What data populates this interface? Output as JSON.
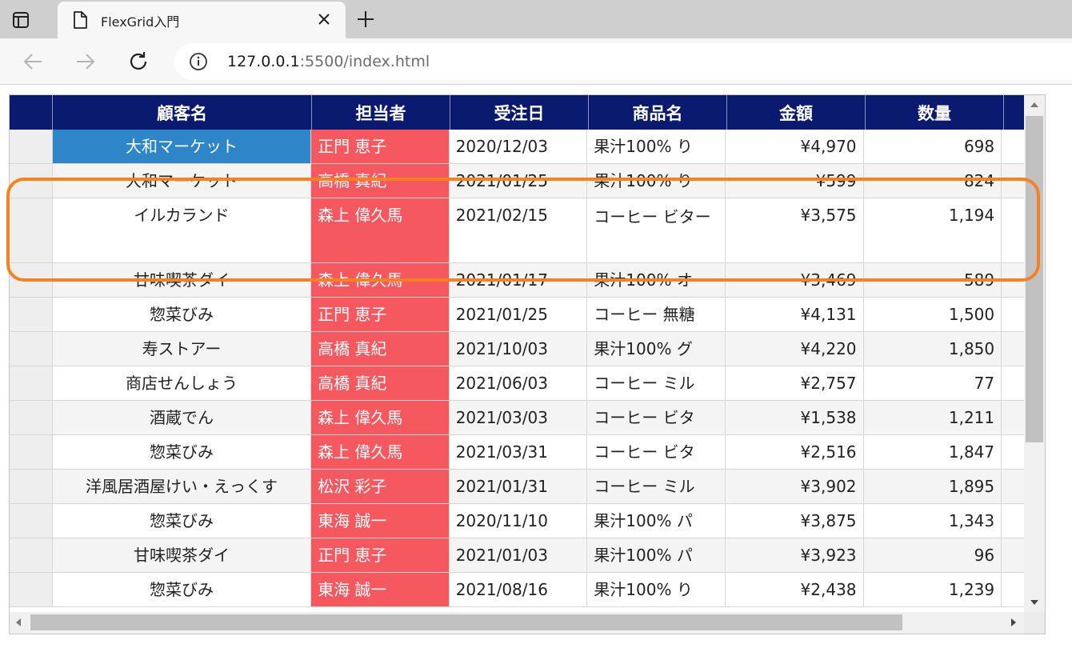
{
  "browser": {
    "tab_title": "FlexGrid入門",
    "url_host": "127.0.0.1",
    "url_path": ":5500/index.html"
  },
  "grid": {
    "columns": [
      "顧客名",
      "担当者",
      "受注日",
      "商品名",
      "金額",
      "数量"
    ],
    "rows": [
      {
        "customer": "大和マーケット",
        "staff": "正門 恵子",
        "date": "2020/12/03",
        "product": "果汁100% り",
        "amount": "¥4,970",
        "qty": "698"
      },
      {
        "customer": "大和マーケット",
        "staff": "高橋 真紀",
        "date": "2021/01/25",
        "product": "果汁100% り",
        "amount": "¥599",
        "qty": "824"
      },
      {
        "customer": "イルカランド",
        "staff": "森上 偉久馬",
        "date": "2021/02/15",
        "product": "コーヒー ビター",
        "amount": "¥3,575",
        "qty": "1,194"
      },
      {
        "customer": "甘味喫茶ダイ",
        "staff": "森上 偉久馬",
        "date": "2021/01/17",
        "product": "果汁100% オ",
        "amount": "¥3,469",
        "qty": "589"
      },
      {
        "customer": "惣菜びみ",
        "staff": "正門 恵子",
        "date": "2021/01/25",
        "product": "コーヒー 無糖",
        "amount": "¥4,131",
        "qty": "1,500"
      },
      {
        "customer": "寿ストアー",
        "staff": "高橋 真紀",
        "date": "2021/10/03",
        "product": "果汁100% グ",
        "amount": "¥4,220",
        "qty": "1,850"
      },
      {
        "customer": "商店せんしょう",
        "staff": "高橋 真紀",
        "date": "2021/06/03",
        "product": "コーヒー ミル",
        "amount": "¥2,757",
        "qty": "77"
      },
      {
        "customer": "酒蔵でん",
        "staff": "森上 偉久馬",
        "date": "2021/03/03",
        "product": "コーヒー ビタ",
        "amount": "¥1,538",
        "qty": "1,211"
      },
      {
        "customer": "惣菜びみ",
        "staff": "森上 偉久馬",
        "date": "2021/03/31",
        "product": "コーヒー ビタ",
        "amount": "¥2,516",
        "qty": "1,847"
      },
      {
        "customer": "洋風居酒屋けい・えっくす",
        "staff": "松沢 彩子",
        "date": "2021/01/31",
        "product": "コーヒー ミル",
        "amount": "¥3,902",
        "qty": "1,895"
      },
      {
        "customer": "惣菜びみ",
        "staff": "東海 誠一",
        "date": "2020/11/10",
        "product": "果汁100% パ",
        "amount": "¥3,875",
        "qty": "1,343"
      },
      {
        "customer": "甘味喫茶ダイ",
        "staff": "正門 恵子",
        "date": "2021/01/03",
        "product": "果汁100% パ",
        "amount": "¥3,923",
        "qty": "96"
      },
      {
        "customer": "惣菜びみ",
        "staff": "東海 誠一",
        "date": "2021/08/16",
        "product": "果汁100% り",
        "amount": "¥2,438",
        "qty": "1,239"
      }
    ]
  },
  "colors": {
    "header_bg": "#0a1a6e",
    "staff_bg": "#f5585e",
    "selected_bg": "#2e86c9",
    "highlight": "#f58220"
  }
}
